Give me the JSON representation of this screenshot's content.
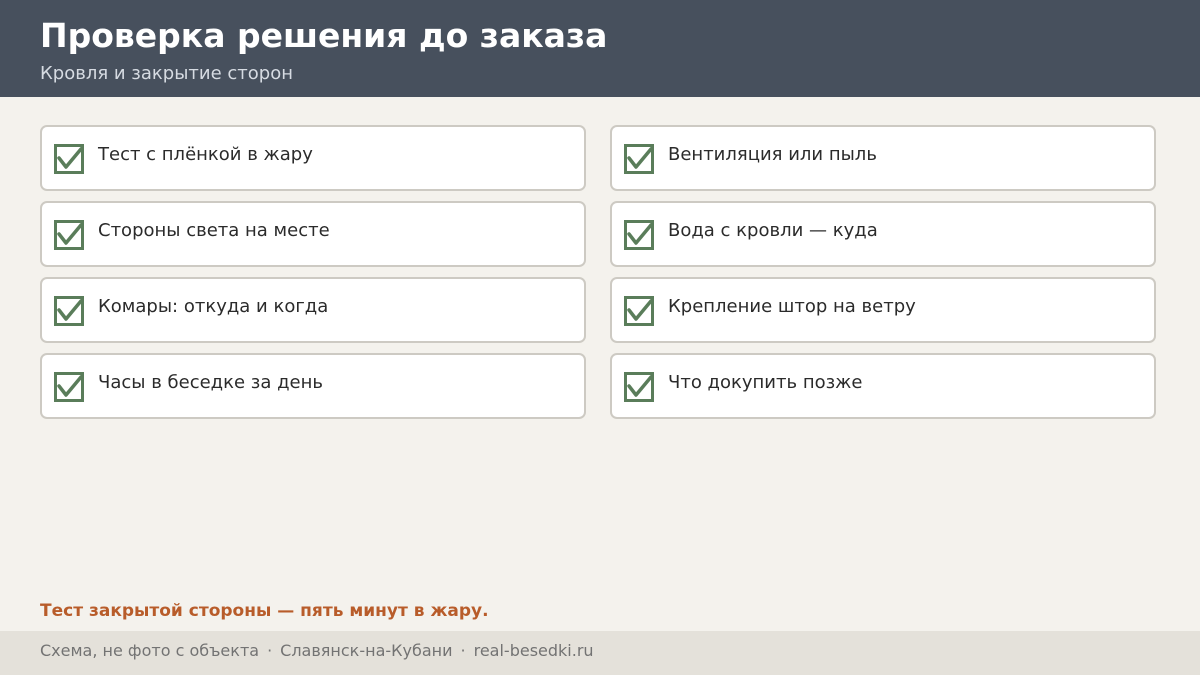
{
  "header": {
    "title": "Проверка решения до заказа",
    "subtitle": "Кровля и закрытие сторон"
  },
  "checklist": {
    "left": [
      {
        "label": "Тест с плёнкой в жару",
        "checked": true
      },
      {
        "label": "Стороны света на месте",
        "checked": true
      },
      {
        "label": "Комары: откуда и когда",
        "checked": true
      },
      {
        "label": "Часы в беседке за день",
        "checked": true
      }
    ],
    "right": [
      {
        "label": "Вентиляция или пыль",
        "checked": true
      },
      {
        "label": "Вода с кровли — куда",
        "checked": true
      },
      {
        "label": "Крепление штор на ветру",
        "checked": true
      },
      {
        "label": "Что докупить позже",
        "checked": true
      }
    ]
  },
  "note": "Тест закрытой стороны — пять минут в жару.",
  "footer": {
    "items": [
      "Схема, не фото с объекта",
      "Славянск-на-Кубани",
      "real-besedki.ru"
    ],
    "separator": "·"
  },
  "colors": {
    "header_bg": "#47505d",
    "page_bg": "#f4f2ed",
    "check_green": "#5a7d5a",
    "accent_orange": "#b85c2a",
    "footer_bg": "#e4e1da"
  },
  "icons": {
    "check": "checkbox-checked-icon"
  }
}
